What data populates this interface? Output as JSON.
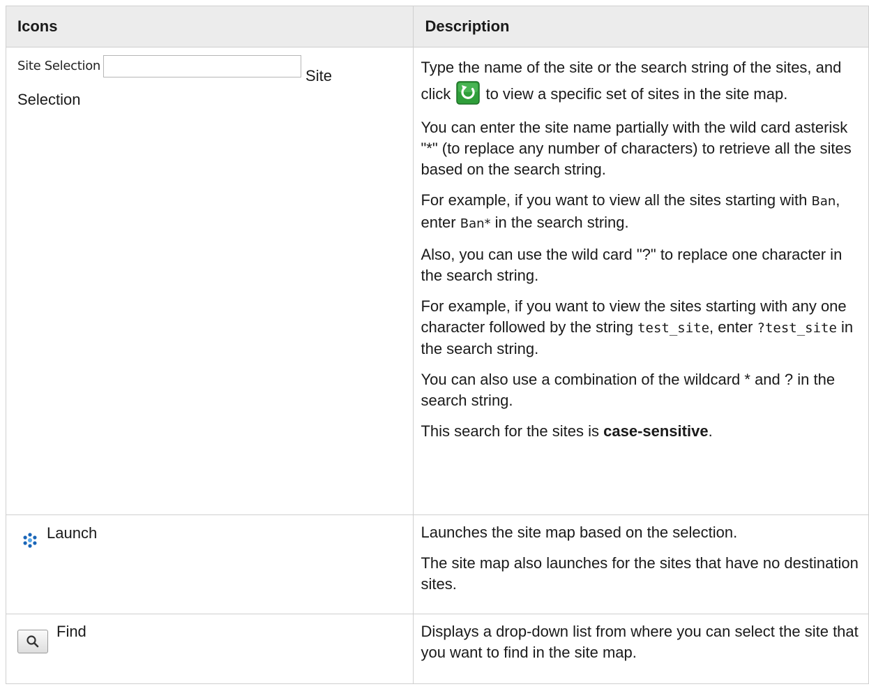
{
  "table": {
    "headers": {
      "icons": "Icons",
      "description": "Description"
    },
    "rows": [
      {
        "site_widget_label": "Site Selection",
        "icon_text_1": "Site",
        "icon_text_2": "Selection",
        "desc": {
          "p1_a": "Type the name of the site or the search string of the sites, and click ",
          "p1_b": " to view a specific set of sites in the site map.",
          "p2": "You can enter the site name partially with the wild card asterisk \"*\" (to replace any number of characters) to retrieve all the sites based on the search string.",
          "p3_a": "For example, if you want to view all the sites starting with ",
          "p3_code1": "Ban",
          "p3_b": ", enter ",
          "p3_code2": "Ban*",
          "p3_c": " in the search string.",
          "p4": "Also, you can use the wild card \"?\" to replace one character in the search string.",
          "p5_a": "For example, if you want to view the sites starting with any one character followed by the string ",
          "p5_code1": "test_site",
          "p5_b": ", enter ",
          "p5_code2": "?test_site",
          "p5_c": " in the search string.",
          "p6": "You can also use a combination of the wildcard * and ? in the search string.",
          "p7_a": "This search for the sites is ",
          "p7_bold": "case-sensitive",
          "p7_b": "."
        }
      },
      {
        "icon_label": "Launch",
        "icon_name": "launch-icon",
        "desc": {
          "p1": "Launches the site map based on the selection.",
          "p2": "The site map also launches for the sites that have no destination sites."
        }
      },
      {
        "icon_label": "Find",
        "icon_name": "find-icon",
        "desc": {
          "p1": "Displays a drop-down list from where you can select the site that you want to find in the site map."
        }
      }
    ]
  },
  "colors": {
    "header_bg": "#ececec",
    "border": "#cfcfcf",
    "refresh_green": "#2f9e3a",
    "launch_blue": "#1a66b8"
  }
}
